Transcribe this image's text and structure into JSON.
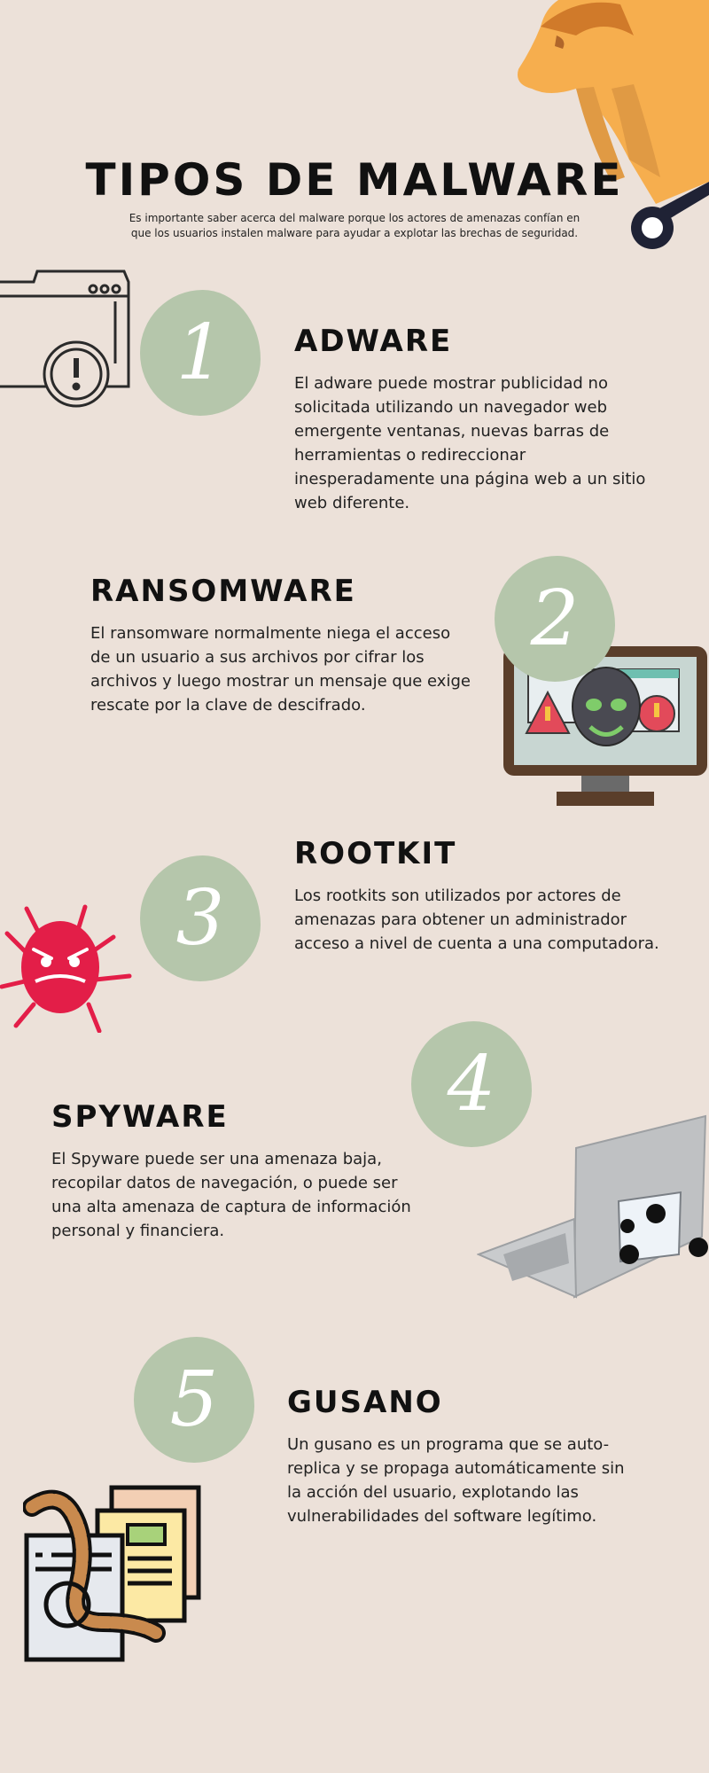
{
  "header": {
    "title": "TIPOS DE MALWARE",
    "subtitle": "Es importante saber acerca del malware porque los actores de amenazas confían en que los usuarios instalen malware para ayudar a explotar las brechas de seguridad."
  },
  "sections": [
    {
      "number": "1",
      "title": "ADWARE",
      "text": "El adware puede mostrar publicidad no solicitada utilizando un navegador web emergente ventanas, nuevas barras de herramientas o redireccionar inesperadamente una página web a un sitio web diferente.",
      "icon": "browser-warning-icon"
    },
    {
      "number": "2",
      "title": "RANSOMWARE",
      "text": "El ransomware normalmente niega el acceso de un usuario a sus archivos por cifrar los archivos y luego mostrar un mensaje que exige rescate por la clave de descifrado.",
      "icon": "infected-monitor-icon"
    },
    {
      "number": "3",
      "title": "ROOTKIT",
      "text": "Los rootkits son utilizados por actores de amenazas para obtener un administrador acceso a nivel de cuenta a una computadora.",
      "icon": "virus-bug-icon"
    },
    {
      "number": "4",
      "title": "SPYWARE",
      "text": "El Spyware puede ser una amenaza baja, recopilar datos de navegación, o puede ser una alta amenaza de captura de información personal y financiera.",
      "icon": "infected-laptop-icon"
    },
    {
      "number": "5",
      "title": "GUSANO",
      "text": "Un gusano es un programa que se auto-replica y se propaga automáticamente sin la acción del usuario, explotando las vulnerabilidades del software legítimo.",
      "icon": "worm-documents-icon"
    }
  ],
  "colors": {
    "background": "#ece1d9",
    "blob": "#b5c6ab",
    "horse": "#f6ae4e",
    "bug": "#e31e48"
  }
}
